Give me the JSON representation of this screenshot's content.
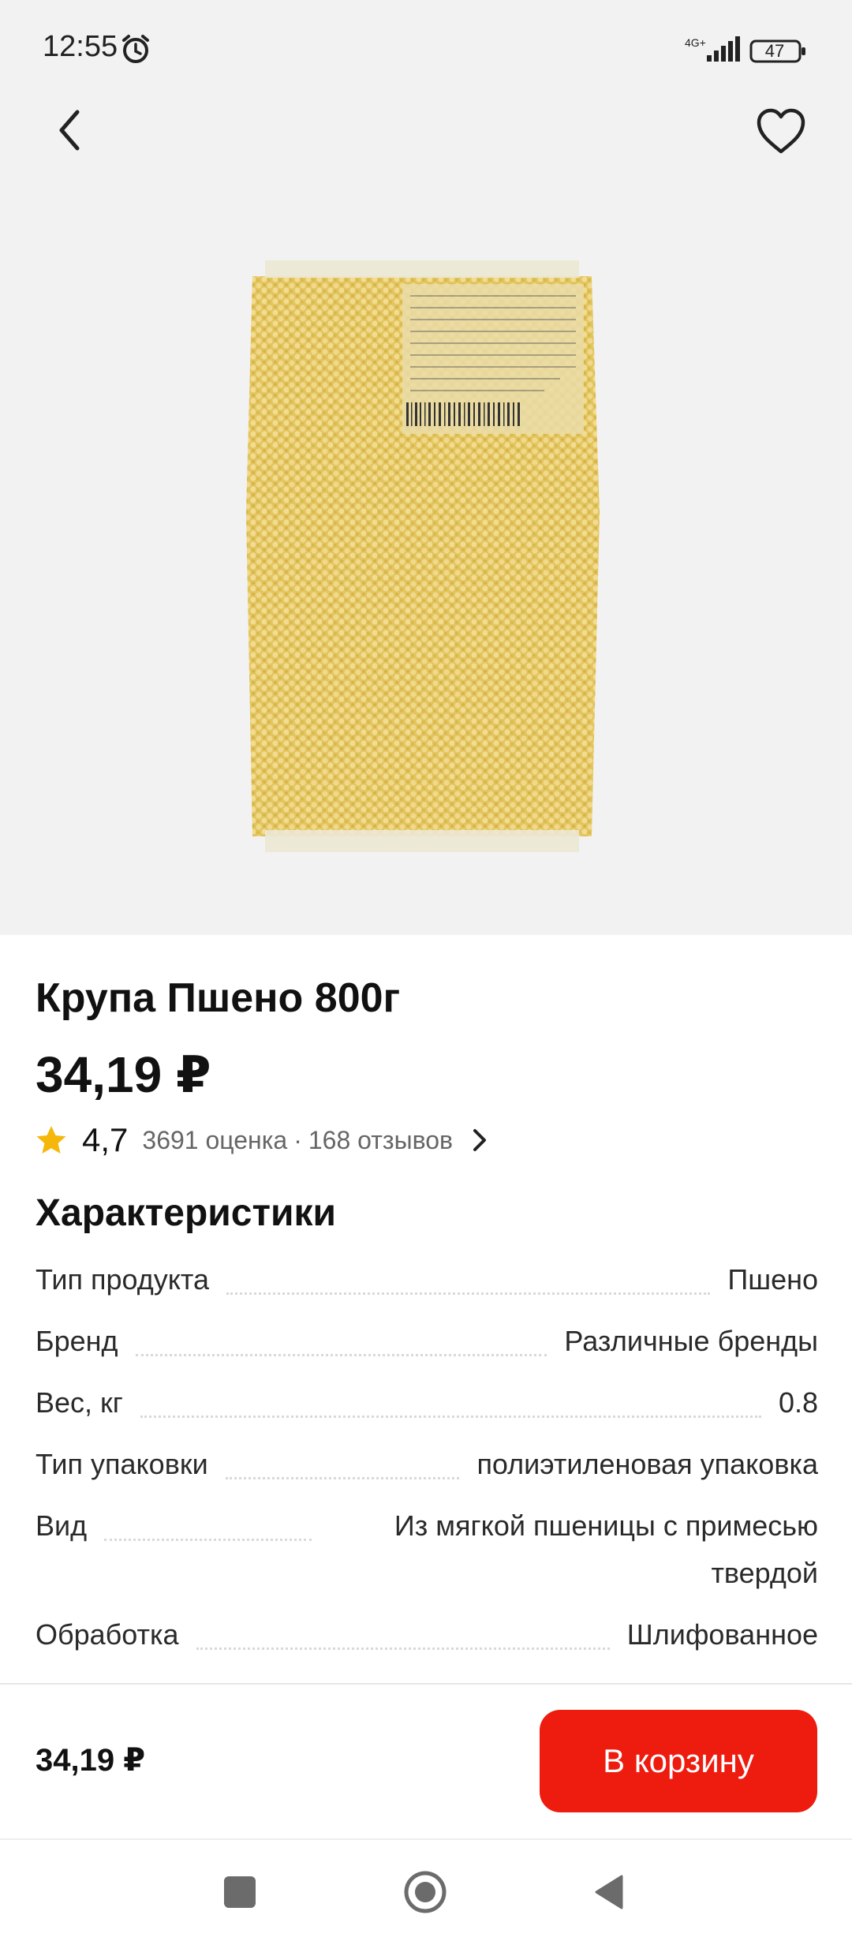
{
  "status_bar": {
    "time": "12:55",
    "network": "4G+",
    "battery": "47"
  },
  "product": {
    "title": "Крупа Пшено 800г",
    "price": "34,19 ₽",
    "rating": "4,7",
    "rating_count": "3691 оценка",
    "separator": "·",
    "reviews_count": "168 отзывов"
  },
  "characteristics": {
    "title": "Характеристики",
    "rows": [
      {
        "label": "Тип продукта",
        "value": "Пшено"
      },
      {
        "label": "Бренд",
        "value": "Различные бренды"
      },
      {
        "label": "Вес, кг",
        "value": "0.8"
      },
      {
        "label": "Тип упаковки",
        "value": "полиэтиленовая упаковка"
      },
      {
        "label": "Вид",
        "value": "Из мягкой пшеницы с примесью твердой"
      },
      {
        "label": "Обработка",
        "value": "Шлифованное"
      }
    ]
  },
  "bottom_bar": {
    "price": "34,19 ₽",
    "cart_button": "В корзину"
  },
  "colors": {
    "accent": "#ee1b0f",
    "star": "#f5b70a",
    "hero_bg": "#f2f2f2"
  },
  "icons": {
    "back": "chevron-left-icon",
    "favorite": "heart-icon",
    "rating": "star-icon",
    "more": "chevron-right-icon"
  }
}
